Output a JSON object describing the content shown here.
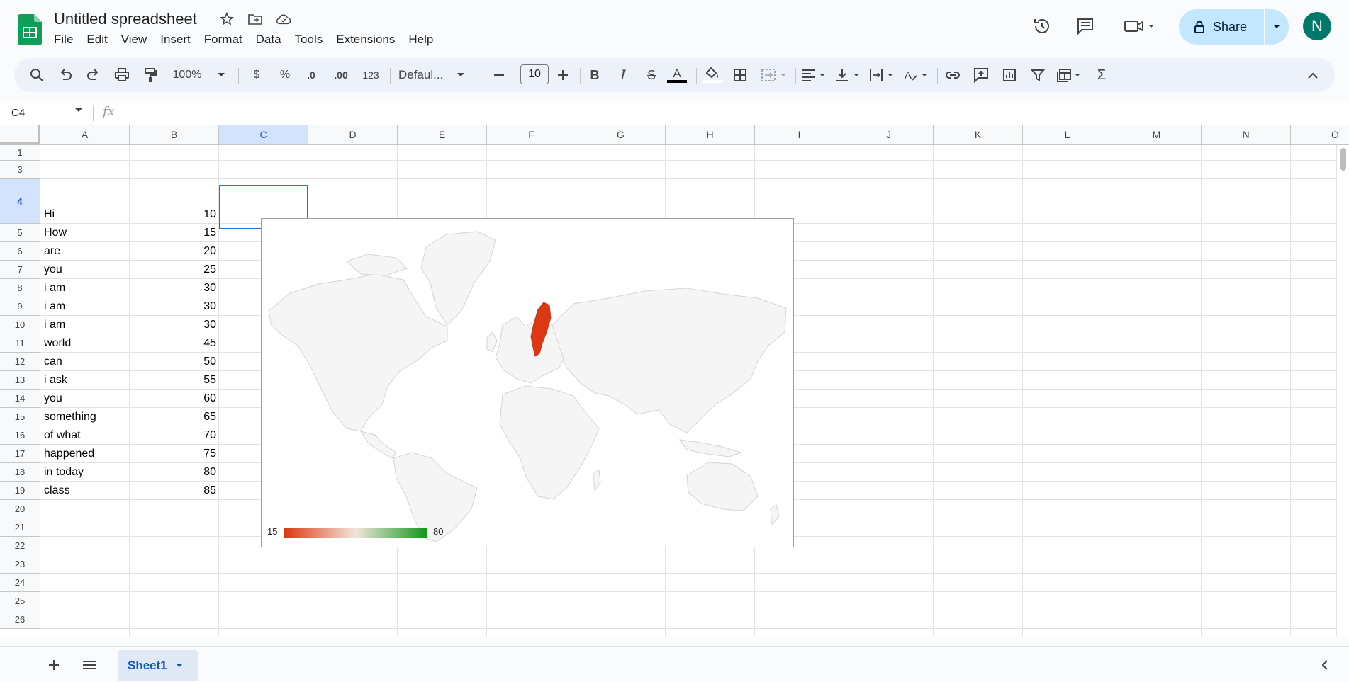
{
  "app": {
    "title": "Untitled spreadsheet",
    "menu": [
      "File",
      "Edit",
      "View",
      "Insert",
      "Format",
      "Data",
      "Tools",
      "Extensions",
      "Help"
    ],
    "share_label": "Share",
    "avatar_letter": "N"
  },
  "toolbar": {
    "zoom": "100%",
    "currency": "$",
    "percent": "%",
    "dec_decrease": ".0",
    "dec_increase": ".00",
    "number_format": "123",
    "font": "Defaul...",
    "font_size": "10",
    "bold": "B",
    "italic": "I",
    "strike": "S",
    "text_color": "A",
    "sum": "Σ"
  },
  "formula_bar": {
    "cell_ref": "C4",
    "fx": "fx",
    "value": ""
  },
  "columns": [
    "A",
    "B",
    "C",
    "D",
    "E",
    "F",
    "G",
    "H",
    "I",
    "J",
    "K",
    "L",
    "M",
    "N",
    "O"
  ],
  "rows": [
    {
      "num": "1",
      "a": "",
      "b": ""
    },
    {
      "num": "3",
      "a": "",
      "b": ""
    },
    {
      "num": "4",
      "a": "Hi",
      "b": "10"
    },
    {
      "num": "5",
      "a": "How",
      "b": "15"
    },
    {
      "num": "6",
      "a": "are",
      "b": "20"
    },
    {
      "num": "7",
      "a": "you",
      "b": "25"
    },
    {
      "num": "8",
      "a": "i am",
      "b": "30"
    },
    {
      "num": "9",
      "a": "i am",
      "b": "30"
    },
    {
      "num": "10",
      "a": "i am",
      "b": "30"
    },
    {
      "num": "11",
      "a": "world",
      "b": "45"
    },
    {
      "num": "12",
      "a": "can",
      "b": "50"
    },
    {
      "num": "13",
      "a": "i ask",
      "b": "55"
    },
    {
      "num": "14",
      "a": "you",
      "b": "60"
    },
    {
      "num": "15",
      "a": "something",
      "b": "65"
    },
    {
      "num": "16",
      "a": "of what",
      "b": "70"
    },
    {
      "num": "17",
      "a": "happened",
      "b": "75"
    },
    {
      "num": "18",
      "a": "in today",
      "b": "80"
    },
    {
      "num": "19",
      "a": "class",
      "b": "85"
    },
    {
      "num": "20",
      "a": "",
      "b": ""
    },
    {
      "num": "21",
      "a": "",
      "b": ""
    },
    {
      "num": "22",
      "a": "",
      "b": ""
    },
    {
      "num": "23",
      "a": "",
      "b": ""
    },
    {
      "num": "24",
      "a": "",
      "b": ""
    },
    {
      "num": "25",
      "a": "",
      "b": ""
    },
    {
      "num": "26",
      "a": "",
      "b": ""
    }
  ],
  "chart": {
    "legend_min": "15",
    "legend_max": "80",
    "highlight_color": "#dc3912"
  },
  "sheet_tab": "Sheet1",
  "colors": {
    "accent": "#0b57d0",
    "share_bg": "#c2e7ff",
    "avatar_bg": "#00796b",
    "sheets_green": "#0f9d58"
  }
}
